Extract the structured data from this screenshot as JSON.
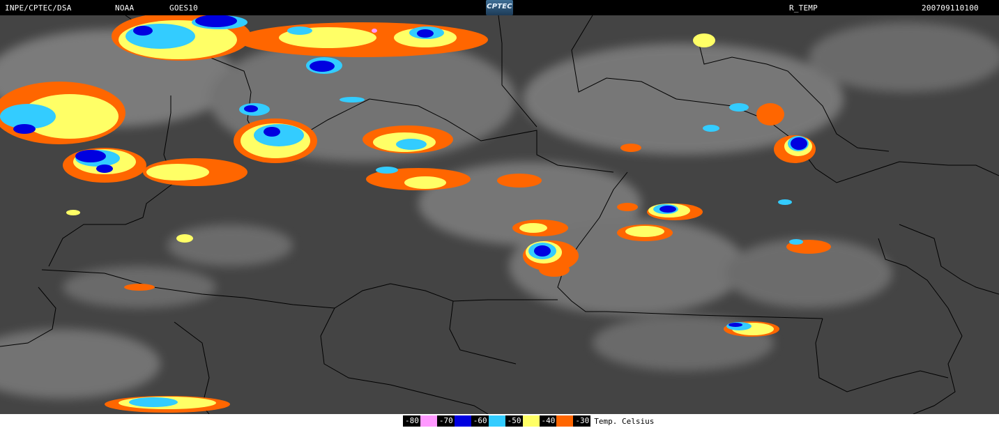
{
  "header": {
    "org": "INPE/CPTEC/DSA",
    "agency": "NOAA",
    "satellite": "GOES10",
    "product": "R_TEMP",
    "datetime": "200709110100",
    "logo_text": "CPTEC"
  },
  "legend": {
    "items": [
      {
        "value": "-80",
        "color": "#ff99ff"
      },
      {
        "value": "-70",
        "color": "#0000e0"
      },
      {
        "value": "-60",
        "color": "#33ccff"
      },
      {
        "value": "-50",
        "color": "#ffff66"
      },
      {
        "value": "-40",
        "color": "#ff6600"
      },
      {
        "value": "-30",
        "color": ""
      }
    ],
    "units": "Temp. Celsius"
  },
  "colors": {
    "background": "#424242",
    "cloud_gray": "#c8c8c8",
    "border": "#000000"
  }
}
